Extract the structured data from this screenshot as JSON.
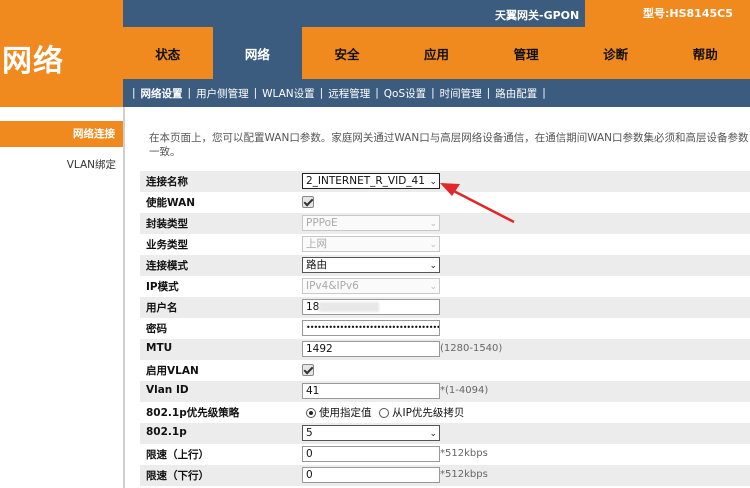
{
  "brand": {
    "text": "网络"
  },
  "header": {
    "gateway_title": "天翼网关-GPON",
    "model_label": "型号:HS8145C5"
  },
  "mainnav": [
    "状态",
    "网络",
    "安全",
    "应用",
    "管理",
    "诊断",
    "帮助"
  ],
  "mainnav_active_index": 1,
  "subnav": [
    "网络设置",
    "用户侧管理",
    "WLAN设置",
    "远程管理",
    "QoS设置",
    "时间管理",
    "路由配置"
  ],
  "subnav_active_index": 0,
  "sidebar": {
    "active": "网络连接",
    "items": [
      "VLAN绑定"
    ]
  },
  "intro": "在本页面上，您可以配置WAN口参数。家庭网关通过WAN口与高层网络设备通信，在通信期间WAN口参数集必须和高层设备参数一致。",
  "form": {
    "conn_name": {
      "label": "连接名称",
      "value": "2_INTERNET_R_VID_41"
    },
    "enable_wan": {
      "label": "使能WAN",
      "checked": true
    },
    "encap": {
      "label": "封装类型",
      "value": "PPPoE"
    },
    "service": {
      "label": "业务类型",
      "value": "上网"
    },
    "conn_mode": {
      "label": "连接模式",
      "value": "路由"
    },
    "ip_mode": {
      "label": "IP模式",
      "value": "IPv4&IPv6"
    },
    "username": {
      "label": "用户名",
      "value": "18"
    },
    "password": {
      "label": "密码",
      "value": "••••••••••••••••••••••••••••••••••••••••••"
    },
    "mtu": {
      "label": "MTU",
      "value": "1492",
      "hint": "(1280-1540)"
    },
    "enable_vlan": {
      "label": "启用VLAN",
      "checked": true
    },
    "vlan_id": {
      "label": "Vlan ID",
      "value": "41",
      "hint": "*(1-4094)"
    },
    "p8021_policy": {
      "label": "802.1p优先级策略",
      "opt1": "使用指定值",
      "opt2": "从IP优先级拷贝"
    },
    "p8021": {
      "label": "802.1p",
      "value": "5"
    },
    "rate_up": {
      "label": "限速（上行）",
      "value": "0",
      "hint": "*512kbps"
    },
    "rate_down": {
      "label": "限速（下行）",
      "value": "0",
      "hint": "*512kbps"
    }
  },
  "colors": {
    "orange": "#f08a1f",
    "navy": "#3b5c7e",
    "arrow": "#e0282a"
  }
}
